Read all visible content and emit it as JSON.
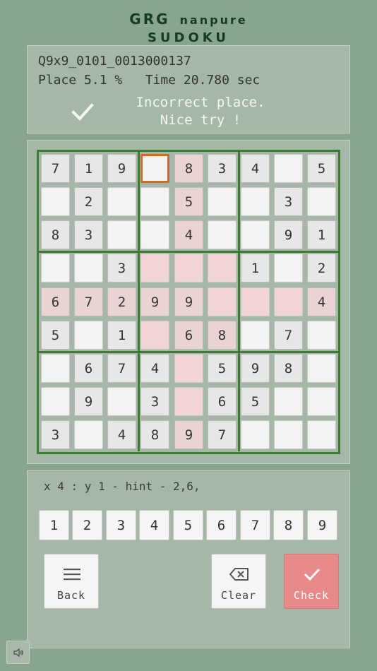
{
  "logo": {
    "brand": "GRG",
    "subtitle": "nanpure",
    "title": "SUDOKU"
  },
  "info": {
    "puzzle_id": "Q9x9_0101_0013000137",
    "stats": "Place 5.1 %   Time 20.780 sec",
    "message_line1": "Incorrect place.",
    "message_line2": "Nice try !",
    "status_icon": "check-icon"
  },
  "board": {
    "rows": [
      [
        "7",
        "1",
        "9",
        "",
        "8",
        "3",
        "4",
        "",
        "5"
      ],
      [
        "",
        "2",
        "",
        "",
        "5",
        "",
        "",
        "3",
        ""
      ],
      [
        "8",
        "3",
        "",
        "",
        "4",
        "",
        "",
        "9",
        "1"
      ],
      [
        "",
        "",
        "3",
        "",
        "",
        "",
        "1",
        "",
        "2"
      ],
      [
        "6",
        "7",
        "2",
        "9",
        "9",
        "",
        "",
        "",
        "4"
      ],
      [
        "5",
        "",
        "1",
        "",
        "6",
        "8",
        "",
        "7",
        ""
      ],
      [
        "",
        "6",
        "7",
        "4",
        "",
        "5",
        "9",
        "8",
        ""
      ],
      [
        "",
        "9",
        "",
        "3",
        "",
        "6",
        "5",
        "",
        ""
      ],
      [
        "3",
        "",
        "4",
        "8",
        "9",
        "7",
        "",
        "",
        ""
      ]
    ],
    "selected": {
      "row": 0,
      "col": 3
    },
    "highlighted_row": 4,
    "highlighted_col": 4,
    "highlighted_box": {
      "row": 1,
      "col": 1
    },
    "conflict_cells": [
      [
        4,
        4
      ]
    ],
    "colors": {
      "grid": "#3e7a33",
      "selection": "#c96b2a",
      "highlight": "#f1d4d4",
      "conflict": "#f29f9f"
    }
  },
  "hint": "x 4 : y 1 - hint - 2,6,",
  "numpad": [
    "1",
    "2",
    "3",
    "4",
    "5",
    "6",
    "7",
    "8",
    "9"
  ],
  "buttons": {
    "back": {
      "label": "Back",
      "icon": "menu-icon"
    },
    "clear": {
      "label": "Clear",
      "icon": "backspace-icon"
    },
    "check": {
      "label": "Check",
      "icon": "check-icon",
      "color": "#e88a8a"
    }
  },
  "sound": {
    "icon": "speaker-icon"
  }
}
